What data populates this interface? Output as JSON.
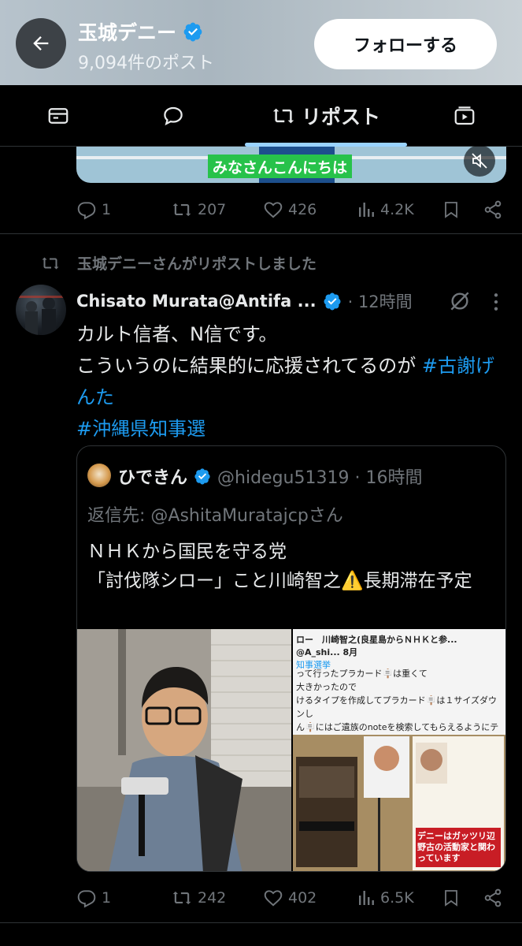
{
  "header": {
    "name": "玉城デニー",
    "post_count": "9,094件のポスト",
    "follow_label": "フォローする"
  },
  "tabs": {
    "active_label": "リポスト"
  },
  "first_post": {
    "caption": "みなさんこんにちは",
    "stats": {
      "replies": "1",
      "reposts": "207",
      "likes": "426",
      "views": "4.2K"
    }
  },
  "repost": {
    "reposted_by": "玉城デニーさんがリポストしました",
    "author": "Chisato Murata@Antifa ...",
    "time": "· 12時間",
    "text_line1": "カルト信者、N信です。",
    "text_line2": "こういうのに結果的に応援されてるのが ",
    "hashtag1": "#古謝げんた",
    "hashtag2": "#沖縄県知事選",
    "quote": {
      "name": "ひできん",
      "handle": "@hidegu51319 · 16時間",
      "reply_to": "返信先: @AshitaMuratajcpさん",
      "line1": "ＮＨＫから国民を守る党",
      "line2": "「討伐隊シロー」こと川崎智之⚠️長期滞在予定",
      "image2": {
        "head": "ロー　川崎智之(良星島からＮＨＫと参... @A_shi... 8月",
        "tag": "知事選挙",
        "body1": "って行ったプラカード🪧は重くて",
        "body2": "大きかったので",
        "body3": "けるタイプを作成してプラカード🪧は１サイズダウンし",
        "body4": "ん🪧にはご遺族のnoteを検索してもらえるようにテキス",
        "sign": "デニーはガッツリ辺野古の活動家と関わっています"
      }
    },
    "stats": {
      "replies": "1",
      "reposts": "242",
      "likes": "402",
      "views": "6.5K"
    }
  },
  "colors": {
    "accent": "#1d9bf0",
    "muted": "#71767b",
    "background": "#000000"
  }
}
